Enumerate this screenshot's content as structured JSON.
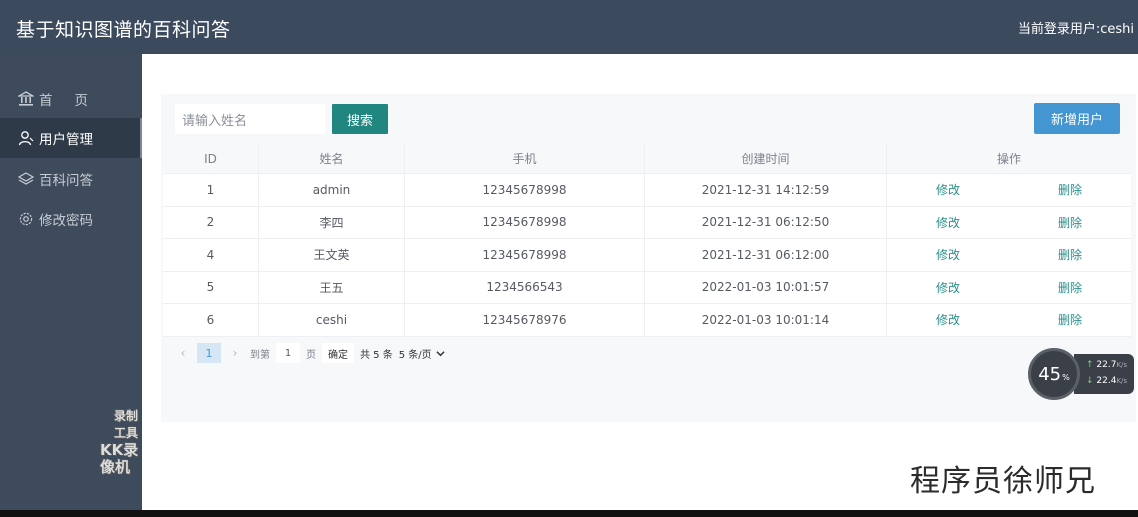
{
  "header": {
    "title": "基于知识图谱的百科问答",
    "current_user": "当前登录用户:ceshi"
  },
  "sidebar": {
    "items": [
      {
        "label": "首页",
        "icon": "bank-icon"
      },
      {
        "label": "用户管理",
        "icon": "user-icon",
        "active": true
      },
      {
        "label": "百科问答",
        "icon": "layers-icon"
      },
      {
        "label": "修改密码",
        "icon": "gear-icon"
      }
    ]
  },
  "toolbar": {
    "search_placeholder": "请输入姓名",
    "search_label": "搜索",
    "add_label": "新增用户"
  },
  "table": {
    "columns": [
      "ID",
      "姓名",
      "手机",
      "创建时间",
      "操作"
    ],
    "rows": [
      {
        "id": "1",
        "name": "admin",
        "phone": "12345678998",
        "created": "2021-12-31 14:12:59"
      },
      {
        "id": "2",
        "name": "李四",
        "phone": "12345678998",
        "created": "2021-12-31 06:12:50"
      },
      {
        "id": "4",
        "name": "王文英",
        "phone": "12345678998",
        "created": "2021-12-31 06:12:00"
      },
      {
        "id": "5",
        "name": "王五",
        "phone": "1234566543",
        "created": "2022-01-03 10:01:57"
      },
      {
        "id": "6",
        "name": "ceshi",
        "phone": "12345678976",
        "created": "2022-01-03 10:01:14"
      }
    ],
    "edit_label": "修改",
    "delete_label": "删除"
  },
  "pagination": {
    "current_page": "1",
    "goto_prefix": "到第",
    "goto_value": "1",
    "goto_suffix": "页",
    "confirm_label": "确定",
    "total_text": "共 5 条",
    "page_size": "5 条/页"
  },
  "overlay": {
    "speed_percent": "45",
    "speed_percent_unit": "%",
    "upload_speed": "22.7",
    "upload_unit": "K/s",
    "download_speed": "22.4",
    "download_unit": "K/s",
    "recorder_line1": "录制工具",
    "recorder_line2": "KK录像机",
    "author": "程序员徐师兄"
  },
  "colors": {
    "header_bg": "#3c4a5d",
    "sidebar_bg": "#3e4b5c",
    "search_button": "#21867f",
    "add_button": "#4496d3",
    "link_color": "#2a8f8a"
  }
}
